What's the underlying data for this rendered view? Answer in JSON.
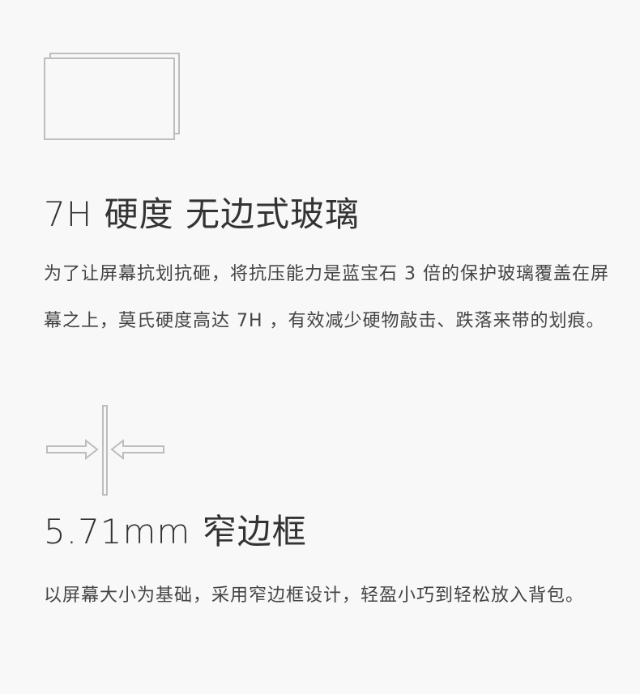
{
  "sections": [
    {
      "icon": "glass-layers-icon",
      "title": "7H 硬度 无边式玻璃",
      "description": "为了让屏幕抗划抗砸，将抗压能力是蓝宝石 3 倍的保护玻璃覆盖在屏幕之上，莫氏硬度高达 7H ，有效减少硬物敲击、跌落来带的划痕。"
    },
    {
      "icon": "narrow-bezel-icon",
      "title": "5.71mm 窄边框",
      "description": "以屏幕大小为基础，采用窄边框设计，轻盈小巧到轻松放入背包。"
    }
  ],
  "colors": {
    "background": "#f8f8f8",
    "text": "#333333",
    "icon_stroke": "#bdbdbd"
  }
}
